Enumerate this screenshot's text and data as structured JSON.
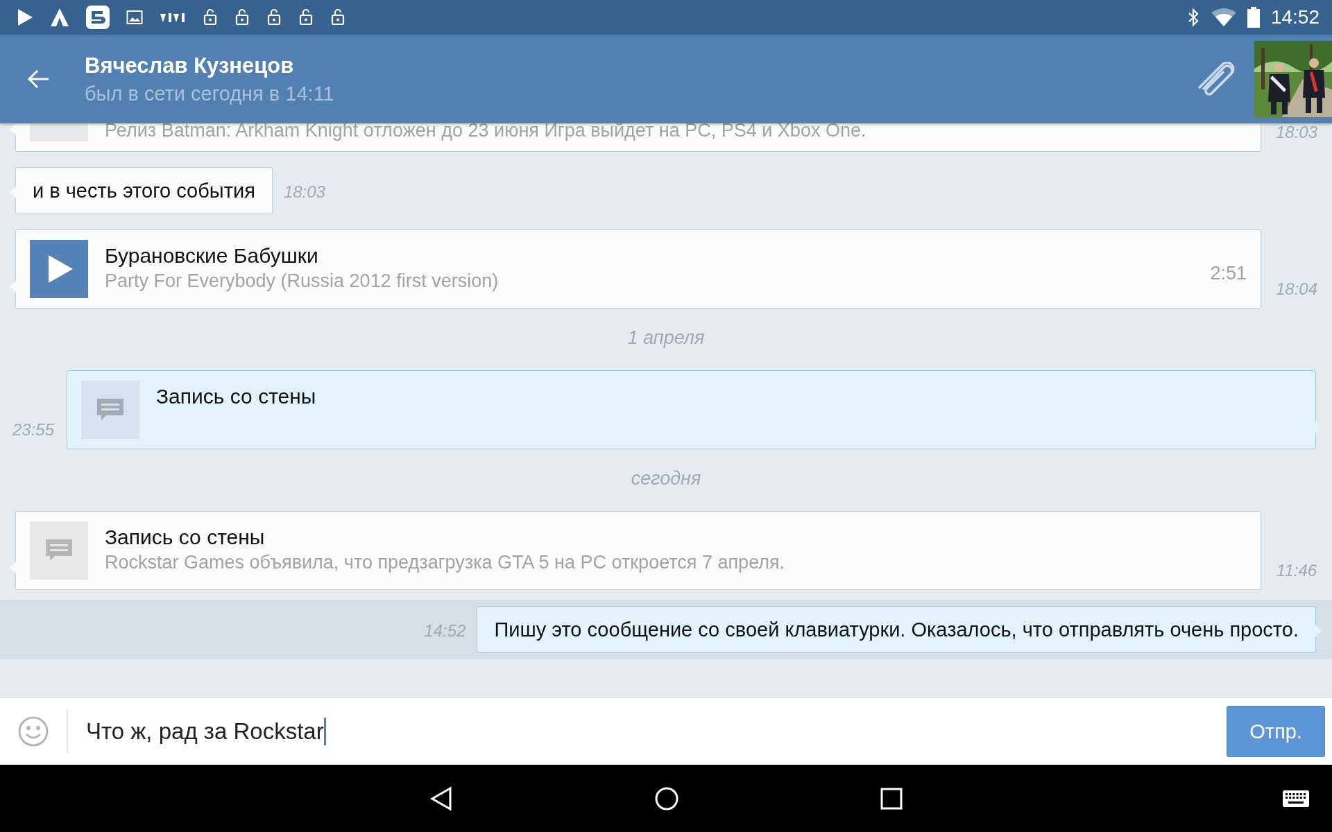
{
  "status_bar": {
    "time": "14:52"
  },
  "header": {
    "title": "Вячеслав Кузнецов",
    "subtitle": "был в сети сегодня в 14:11"
  },
  "messages": [
    {
      "kind": "wall_post",
      "outgoing": false,
      "highlighted": false,
      "text": "Релиз Batman: Arkham Knight отложен до 23 июня  Игра выйдет на PC, PS4 и Xbox One.",
      "time": "18:03"
    },
    {
      "kind": "text",
      "outgoing": false,
      "highlighted": false,
      "text": "и в честь этого события",
      "time": "18:03"
    },
    {
      "kind": "audio",
      "outgoing": false,
      "highlighted": false,
      "title": "Бурановские Бабушки",
      "text": "Party For Everybody (Russia 2012 first version)",
      "duration": "2:51",
      "time": "18:04"
    },
    {
      "kind": "date",
      "label": "1 апреля"
    },
    {
      "kind": "wall_post",
      "outgoing": true,
      "highlighted": false,
      "title": "Запись со стены",
      "time": "23:55"
    },
    {
      "kind": "date",
      "label": "сегодня"
    },
    {
      "kind": "wall_post",
      "outgoing": false,
      "highlighted": false,
      "title": "Запись со стены",
      "text": "Rockstar Games объявила, что предзагрузка GTA 5 на PC откроется 7 апреля.",
      "time": "11:46"
    },
    {
      "kind": "text",
      "outgoing": true,
      "highlighted": true,
      "text": "Пишу это сообщение со своей клавиатурки. Оказалось, что отправлять очень просто.",
      "time": "14:52"
    }
  ],
  "composer": {
    "value": "Что ж, рад за Rockstar",
    "send_label": "Отпр."
  }
}
